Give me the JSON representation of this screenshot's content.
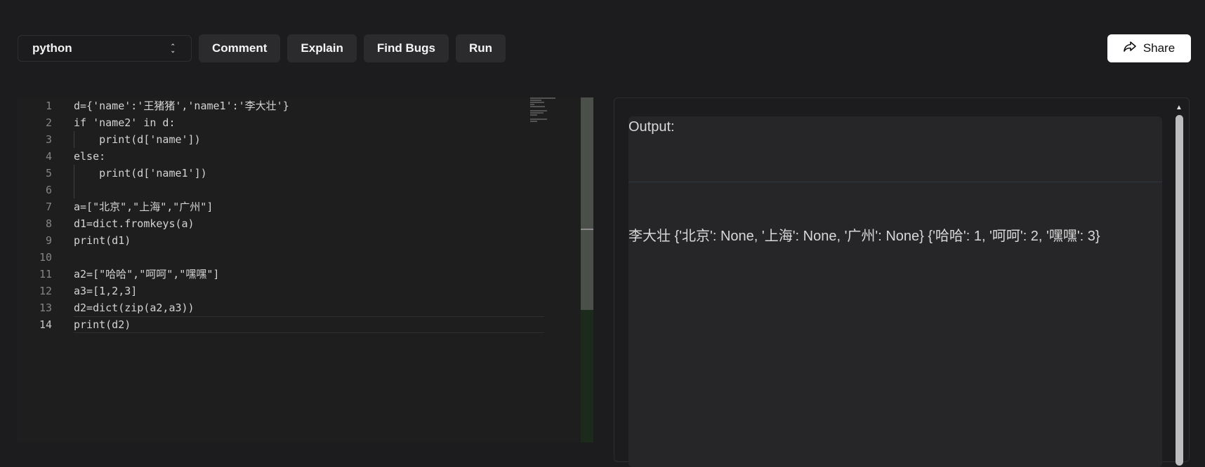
{
  "toolbar": {
    "language": "python",
    "buttons": [
      "Comment",
      "Explain",
      "Find Bugs",
      "Run"
    ],
    "share_label": "Share"
  },
  "editor": {
    "active_line": 14,
    "lines": [
      {
        "n": "1",
        "text": "d={'name':'王猪猪','name1':'李大壮'}"
      },
      {
        "n": "2",
        "text": "if 'name2' in d:"
      },
      {
        "n": "3",
        "text": "    print(d['name'])"
      },
      {
        "n": "4",
        "text": "else:"
      },
      {
        "n": "5",
        "text": "    print(d['name1'])"
      },
      {
        "n": "6",
        "text": ""
      },
      {
        "n": "7",
        "text": "a=[\"北京\",\"上海\",\"广州\"]"
      },
      {
        "n": "8",
        "text": "d1=dict.fromkeys(a)"
      },
      {
        "n": "9",
        "text": "print(d1)"
      },
      {
        "n": "10",
        "text": ""
      },
      {
        "n": "11",
        "text": "a2=[\"哈哈\",\"呵呵\",\"嘿嘿\"]"
      },
      {
        "n": "12",
        "text": "a3=[1,2,3]"
      },
      {
        "n": "13",
        "text": "d2=dict(zip(a2,a3))"
      },
      {
        "n": "14",
        "text": "print(d2)"
      }
    ]
  },
  "output": {
    "label": "Output:",
    "text": "李大壮 {'北京': None, '上海': None, '广州': None} {'哈哈': 1, '呵呵': 2, '嘿嘿': 3}"
  }
}
